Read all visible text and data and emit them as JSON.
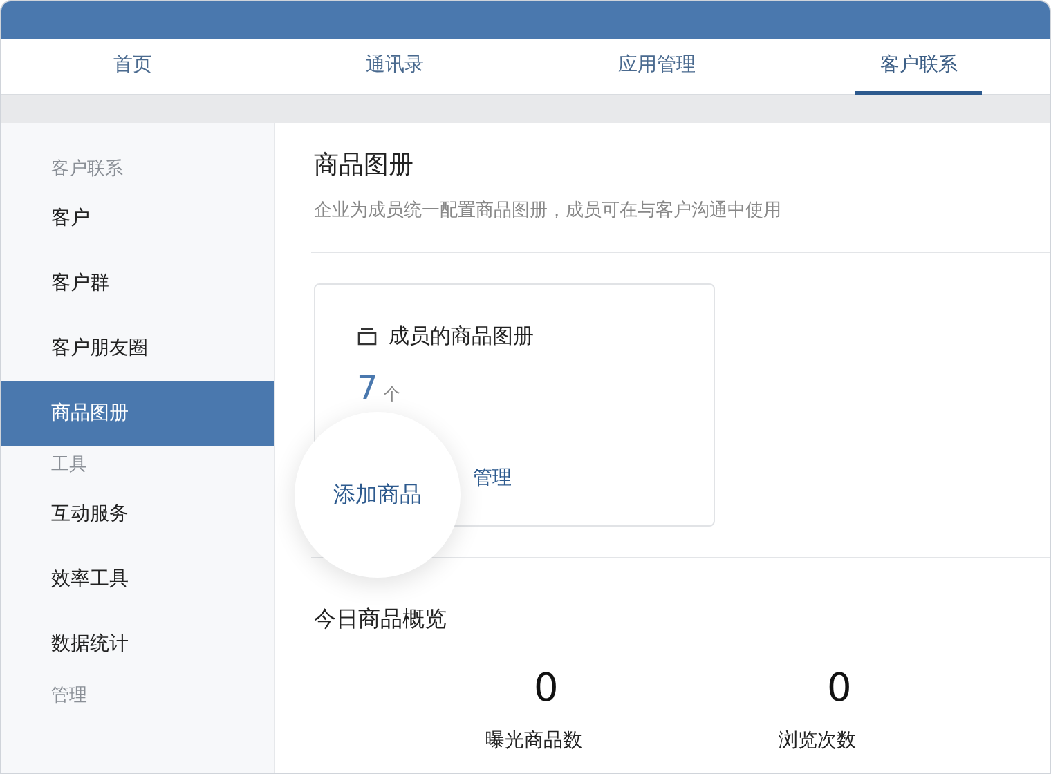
{
  "tabs": [
    {
      "label": "首页",
      "selected": false
    },
    {
      "label": "通讯录",
      "selected": false
    },
    {
      "label": "应用管理",
      "selected": false
    },
    {
      "label": "客户联系",
      "selected": true
    }
  ],
  "sidebar": {
    "items": [
      {
        "kind": "group",
        "label": "客户联系"
      },
      {
        "kind": "item",
        "label": "客户",
        "selected": false
      },
      {
        "kind": "item",
        "label": "客户群",
        "selected": false
      },
      {
        "kind": "item",
        "label": "客户朋友圈",
        "selected": false
      },
      {
        "kind": "item",
        "label": "商品图册",
        "selected": true
      },
      {
        "kind": "group",
        "label": "工具"
      },
      {
        "kind": "item",
        "label": "互动服务",
        "selected": false
      },
      {
        "kind": "item",
        "label": "效率工具",
        "selected": false
      },
      {
        "kind": "item",
        "label": "数据统计",
        "selected": false
      },
      {
        "kind": "group",
        "label": "管理"
      }
    ]
  },
  "page": {
    "title": "商品图册",
    "subtitle": "企业为成员统一配置商品图册，成员可在与客户沟通中使用"
  },
  "card": {
    "title": "成员的商品图册",
    "count": "7",
    "unit": "个",
    "magnified_link": "添加商品",
    "link": "管理"
  },
  "overview": {
    "title": "今日商品概览",
    "stats": [
      {
        "value": "0",
        "label": "曝光商品数"
      },
      {
        "value": "0",
        "label": "浏览次数"
      }
    ]
  }
}
